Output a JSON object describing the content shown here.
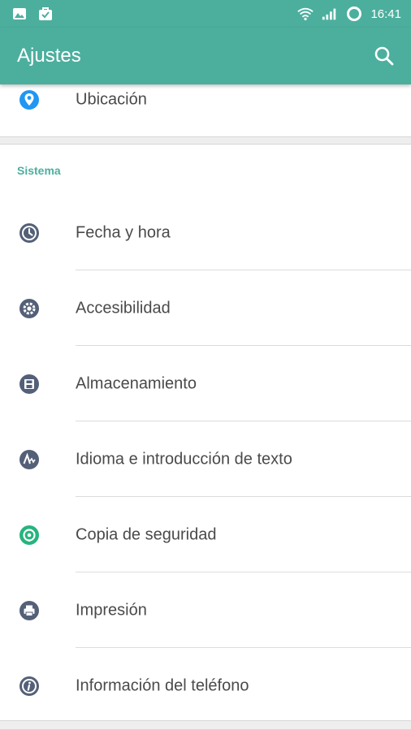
{
  "status_bar": {
    "time": "16:41",
    "left_icons": [
      "image-icon",
      "bag-check-icon"
    ],
    "right_icons": [
      "wifi-icon",
      "signal-icon",
      "sync-ring-icon"
    ]
  },
  "app_bar": {
    "title": "Ajustes",
    "search_icon": "search-icon",
    "color": "#4caf9e"
  },
  "top_item": {
    "label": "Ubicación",
    "icon": "location-pin-icon",
    "icon_color": "#2196f3"
  },
  "section": {
    "header": "Sistema",
    "header_color": "#4caf9e",
    "items": [
      {
        "label": "Fecha y hora",
        "icon": "clock-icon",
        "icon_color": "#546078"
      },
      {
        "label": "Accesibilidad",
        "icon": "accessibility-gear-icon",
        "icon_color": "#546078"
      },
      {
        "label": "Almacenamiento",
        "icon": "storage-floppy-icon",
        "icon_color": "#546078"
      },
      {
        "label": "Idioma e introducción de texto",
        "icon": "language-icon",
        "icon_color": "#546078"
      },
      {
        "label": "Copia de seguridad",
        "icon": "backup-icon",
        "icon_color": "#26b47e"
      },
      {
        "label": "Impresión",
        "icon": "printer-icon",
        "icon_color": "#546078"
      },
      {
        "label": "Información del teléfono",
        "icon": "info-icon",
        "icon_color": "#546078"
      }
    ]
  }
}
